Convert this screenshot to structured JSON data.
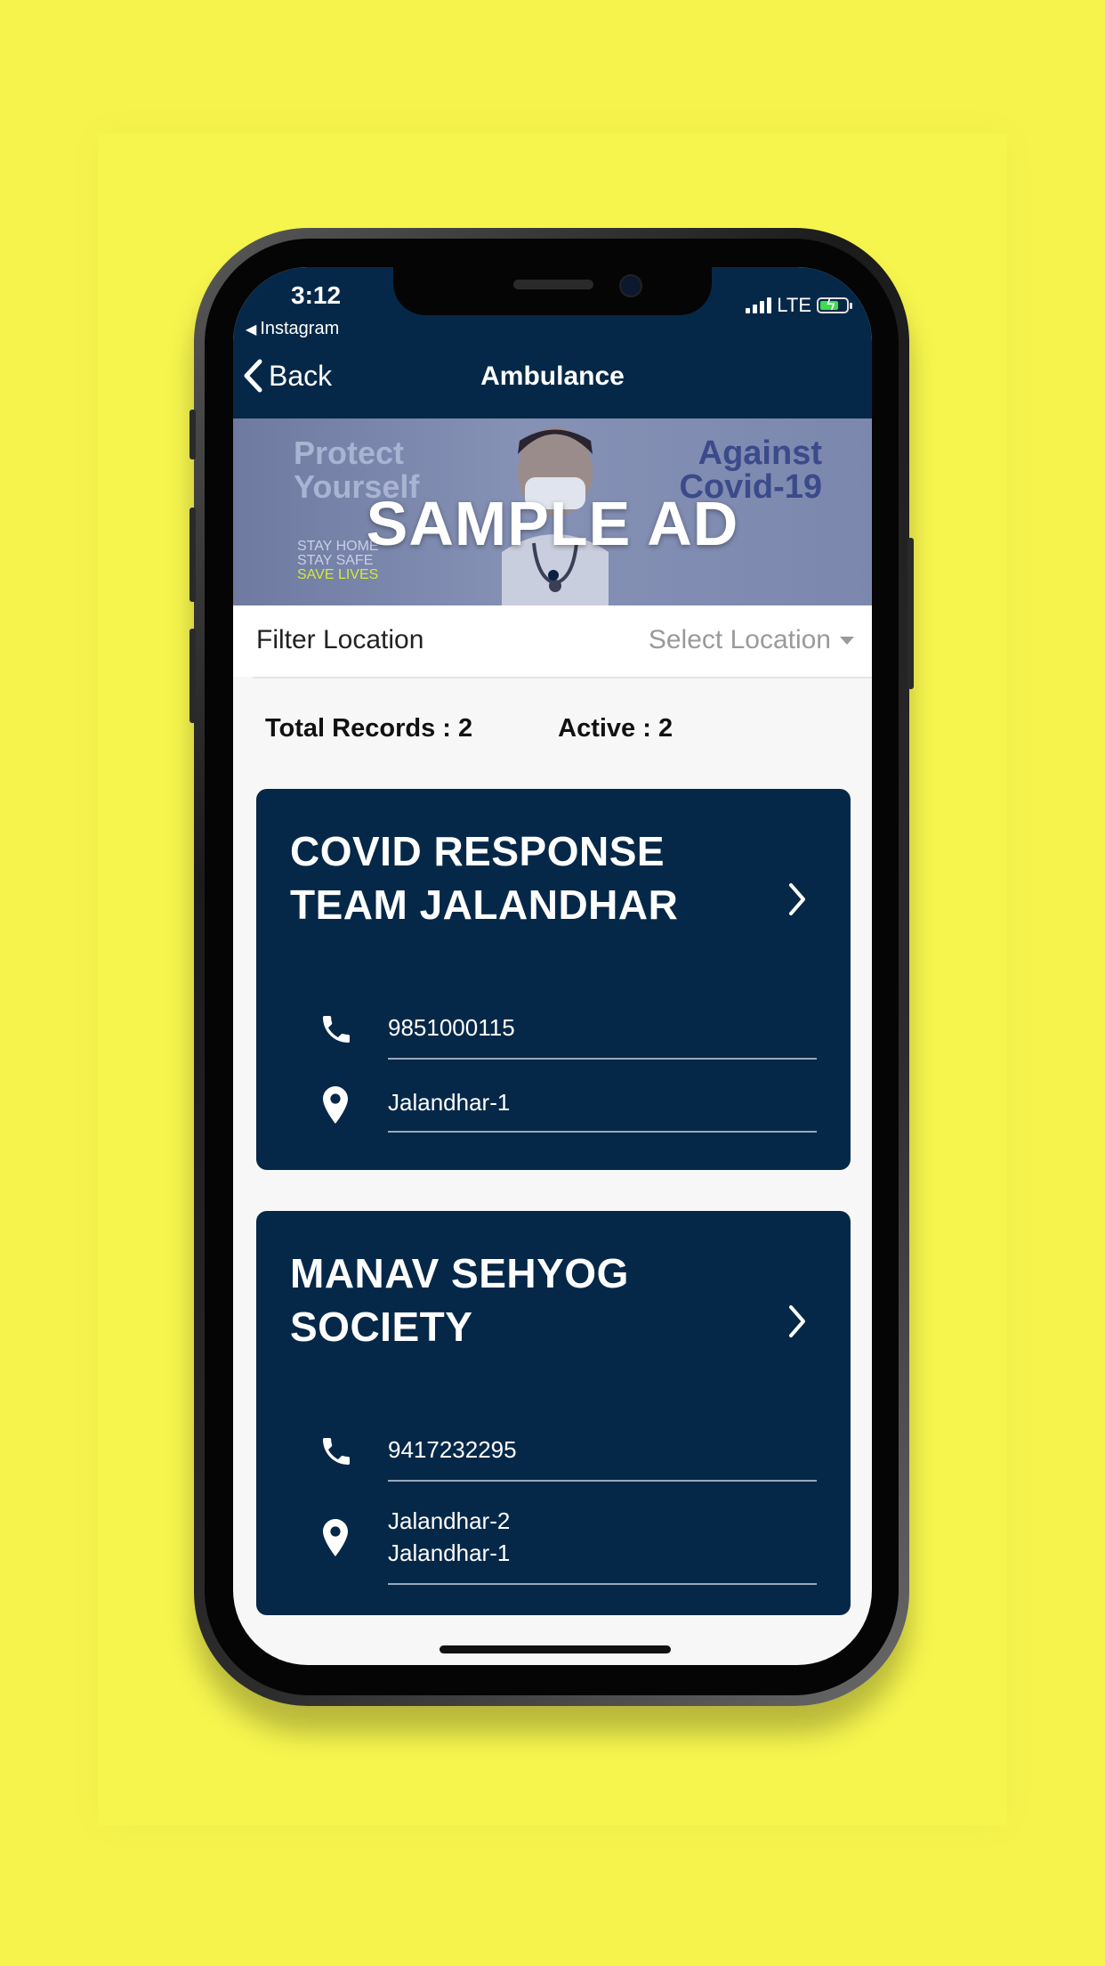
{
  "status_bar": {
    "time": "3:12",
    "back_app": "Instagram",
    "network": "LTE"
  },
  "nav": {
    "back_label": "Back",
    "title": "Ambulance"
  },
  "ad": {
    "left_line1": "Protect",
    "left_line2": "Yourself",
    "right_line1": "Against",
    "right_line2": "Covid-19",
    "small1": "STAY HOME",
    "small2": "STAY SAFE",
    "small3": "SAVE LIVES",
    "main": "SAMPLE AD"
  },
  "filter": {
    "label": "Filter Location",
    "select_placeholder": "Select Location"
  },
  "stats": {
    "total": "Total Records : 2",
    "active": "Active : 2"
  },
  "cards": [
    {
      "title_line1": "COVID RESPONSE",
      "title_line2": "TEAM JALANDHAR",
      "phone": "9851000115",
      "locations": [
        "Jalandhar-1"
      ]
    },
    {
      "title_line1": "MANAV SEHYOG",
      "title_line2": "SOCIETY",
      "phone": "9417232295",
      "locations": [
        "Jalandhar-2",
        "Jalandhar-1"
      ]
    }
  ],
  "colors": {
    "background": "#f6f44c",
    "header": "#062848",
    "card": "#062848"
  }
}
